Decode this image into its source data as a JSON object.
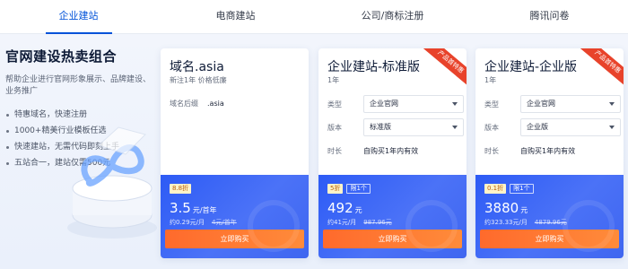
{
  "tabs": [
    "企业建站",
    "电商建站",
    "公司/商标注册",
    "腾讯问卷"
  ],
  "intro": {
    "title": "官网建设热卖组合",
    "subtitle": "帮助企业进行官网形象展示、品牌建设、业务推广",
    "bullets": [
      "特惠域名，快速注册",
      "1000+精美行业模板任选",
      "快速建站，无需代码即刻上手",
      "五站合一，建站仅需500元"
    ]
  },
  "cards": [
    {
      "title": "域名.asia",
      "meta": "新注1年 价格低廉",
      "suffix_label": "域名后缀",
      "suffix_value": ".asia",
      "discount_tag": "8.8折",
      "price": "3.5",
      "price_unit": "元/首年",
      "sub_price": "约0.29元/月",
      "orig_price": "4元/首年",
      "buy_label": "立即购买"
    },
    {
      "title": "企业建站-标准版",
      "meta": "1年",
      "ribbon": "产品首特惠",
      "type_label": "类型",
      "type_value": "企业官网",
      "edition_label": "版本",
      "edition_value": "标准版",
      "duration_label": "时长",
      "duration_value": "自购买1年内有效",
      "discount_tag": "5折",
      "limit_tag": "限1个",
      "price": "492",
      "price_unit": "元",
      "sub_price": "约41元/月",
      "orig_price": "987.96元",
      "buy_label": "立即购买"
    },
    {
      "title": "企业建站-企业版",
      "meta": "1年",
      "ribbon": "产品首特惠",
      "type_label": "类型",
      "type_value": "企业官网",
      "edition_label": "版本",
      "edition_value": "企业版",
      "duration_label": "时长",
      "duration_value": "自购买1年内有效",
      "discount_tag": "0.1折",
      "limit_tag": "限1个",
      "price": "3880",
      "price_unit": "元",
      "sub_price": "约323.33元/月",
      "orig_price": "4879.96元",
      "buy_label": "立即购买"
    }
  ],
  "colors": {
    "accent": "#0052d9",
    "price_box": "#3f66f0",
    "buy_button": "#ff7a33",
    "ribbon": "#e8432b"
  }
}
